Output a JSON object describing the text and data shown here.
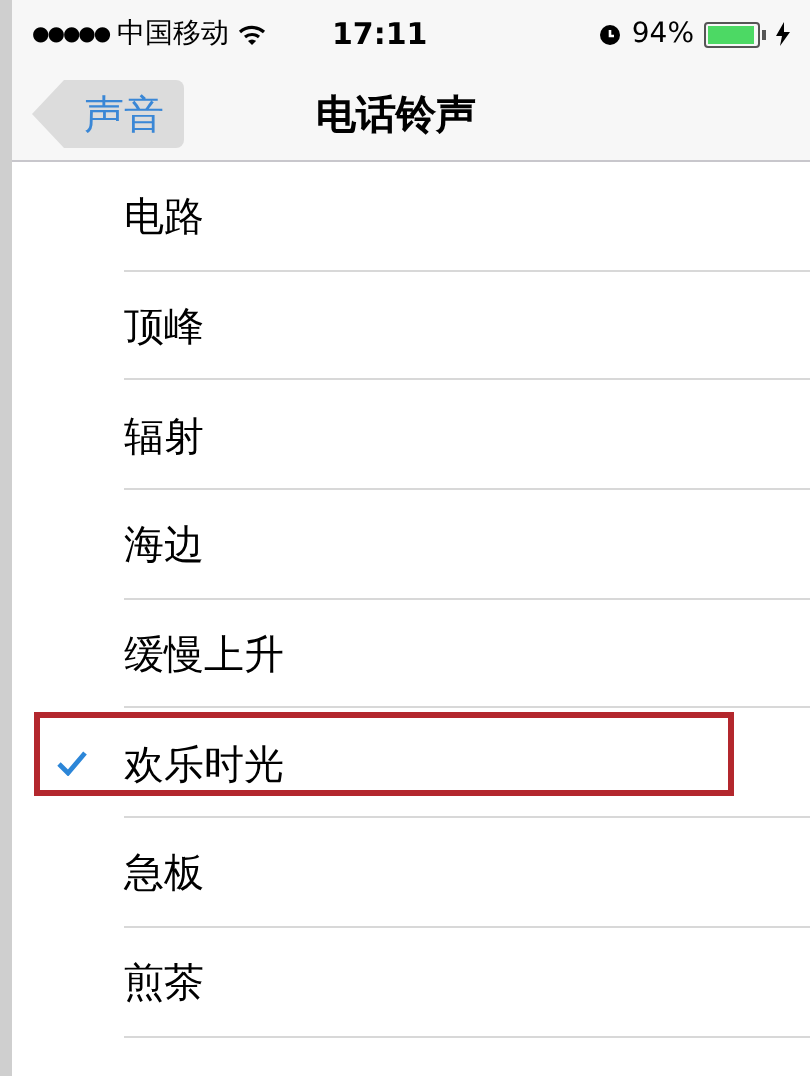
{
  "status_bar": {
    "signal_dots": "●●●●●",
    "carrier": "中国移动",
    "time": "17:11",
    "battery": {
      "percent": "94%",
      "level": 0.94
    }
  },
  "nav": {
    "back": "声音",
    "title": "电话铃声"
  },
  "ringtones": [
    {
      "label": "电路",
      "selected": false,
      "highlighted": false
    },
    {
      "label": "顶峰",
      "selected": false,
      "highlighted": false
    },
    {
      "label": "辐射",
      "selected": false,
      "highlighted": false
    },
    {
      "label": "海边",
      "selected": false,
      "highlighted": false
    },
    {
      "label": "缓慢上升",
      "selected": false,
      "highlighted": false
    },
    {
      "label": "欢乐时光",
      "selected": true,
      "highlighted": true
    },
    {
      "label": "急板",
      "selected": false,
      "highlighted": false
    },
    {
      "label": "煎茶",
      "selected": false,
      "highlighted": false
    }
  ]
}
